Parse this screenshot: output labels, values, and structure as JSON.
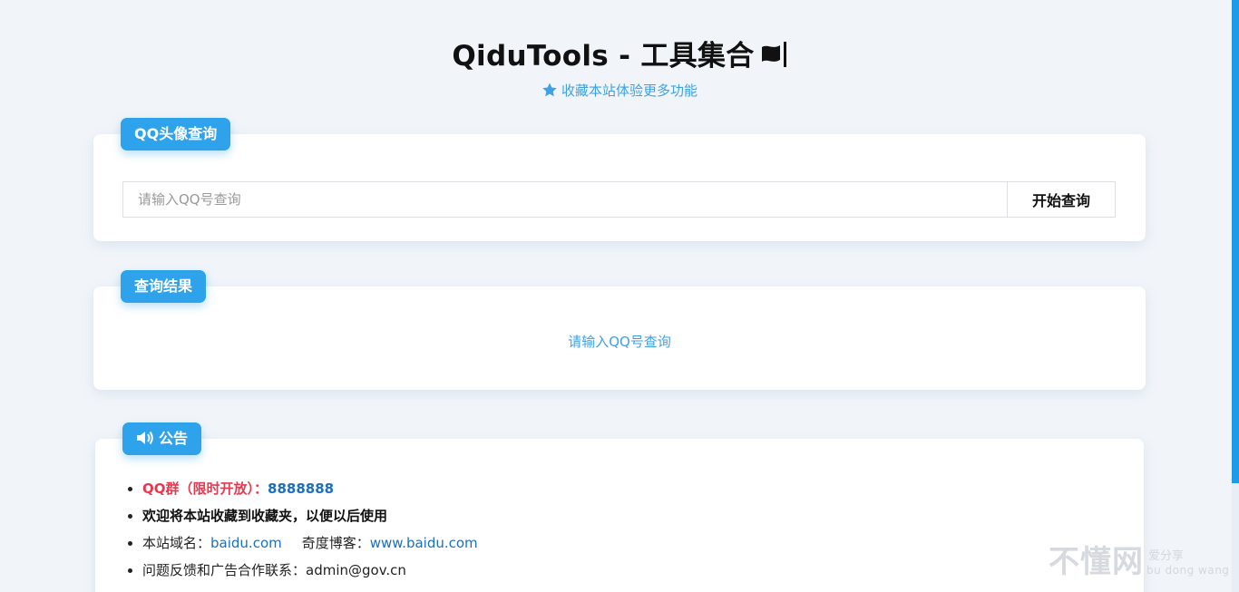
{
  "header": {
    "title": "QiduTools - 工具集合",
    "subtitle": "收藏本站体验更多功能"
  },
  "avatar_card": {
    "badge": "QQ头像查询",
    "input_placeholder": "请输入QQ号查询",
    "input_value": "",
    "button_label": "开始查询"
  },
  "result_card": {
    "badge": "查询结果",
    "message": "请输入QQ号查询"
  },
  "notice_card": {
    "badge": "公告",
    "qq_group_label": "QQ群（限时开放）：",
    "qq_group_value": "8888888",
    "favorite_text": "欢迎将本站收藏到收藏夹，以便以后使用",
    "domain_label": "本站域名：",
    "domain_value": "baidu.com",
    "blog_label": "奇度博客：",
    "blog_value": "www.baidu.com",
    "contact_text": "问题反馈和广告合作联系：admin@gov.cn"
  },
  "watermark": {
    "main": "不懂网",
    "top": "爱分享",
    "bottom": "bu dong wang"
  },
  "colors": {
    "accent": "#2ea3ec",
    "link": "#1b6fc0",
    "highlight": "#e8384f",
    "background": "#f1f5fa"
  },
  "icons": {
    "title_icon": "flag-icon",
    "subtitle_icon": "star-icon",
    "notice_icon": "speaker-icon"
  }
}
